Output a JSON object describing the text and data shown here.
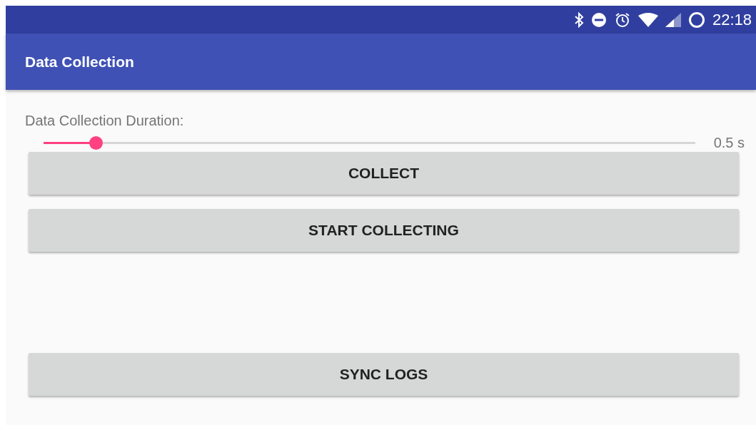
{
  "status_bar": {
    "time": "22:18"
  },
  "app_bar": {
    "title": "Data Collection"
  },
  "duration": {
    "label": "Data Collection Duration:",
    "level": 0.08,
    "reading": "0.5 s"
  },
  "buttons": [
    {
      "label": "COLLECT"
    },
    {
      "label": "START COLLECTING"
    }
  ],
  "bottom_button": {
    "label": "SYNC LOGS"
  }
}
